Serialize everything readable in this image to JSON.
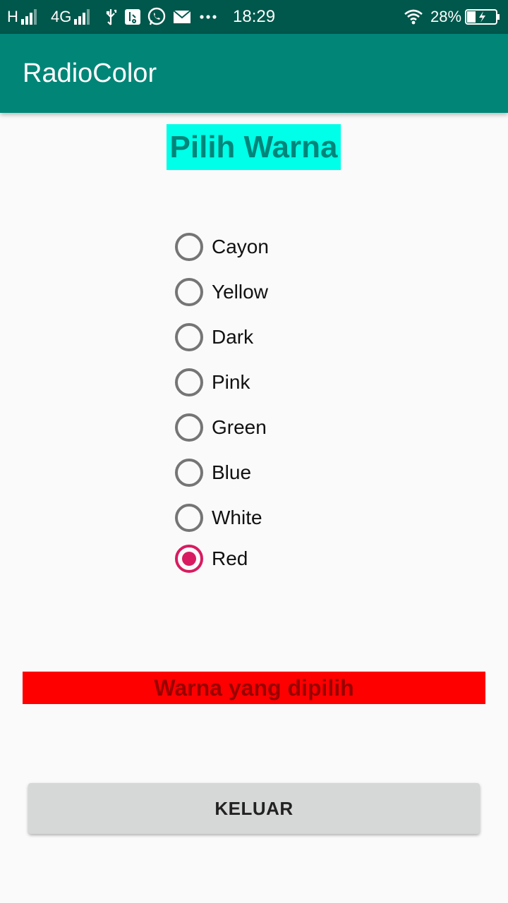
{
  "status_bar": {
    "network_h": "H",
    "network_4g": "4G",
    "time": "18:29",
    "battery": "28%",
    "icons": [
      "signal-icon",
      "usb-icon",
      "usb-debug-icon",
      "whatsapp-icon",
      "mail-icon",
      "more-icon",
      "wifi-icon",
      "battery-charging-icon"
    ]
  },
  "toolbar": {
    "title": "RadioColor"
  },
  "heading": {
    "text": "Pilih Warna"
  },
  "radio_options": [
    {
      "label": "Cayon",
      "checked": false
    },
    {
      "label": "Yellow",
      "checked": false
    },
    {
      "label": "Dark",
      "checked": false
    },
    {
      "label": "Pink",
      "checked": false
    },
    {
      "label": "Green",
      "checked": false
    },
    {
      "label": "Blue",
      "checked": false
    },
    {
      "label": "White",
      "checked": false
    },
    {
      "label": "Red",
      "checked": true
    }
  ],
  "result": {
    "text": "Warna yang dipilih"
  },
  "exit_button": {
    "label": "KELUAR"
  },
  "colors": {
    "primary": "#008577",
    "primary_dark": "#00574b",
    "accent": "#d81b60",
    "heading_bg": "#00ffe8",
    "result_bg": "#ff0000"
  }
}
